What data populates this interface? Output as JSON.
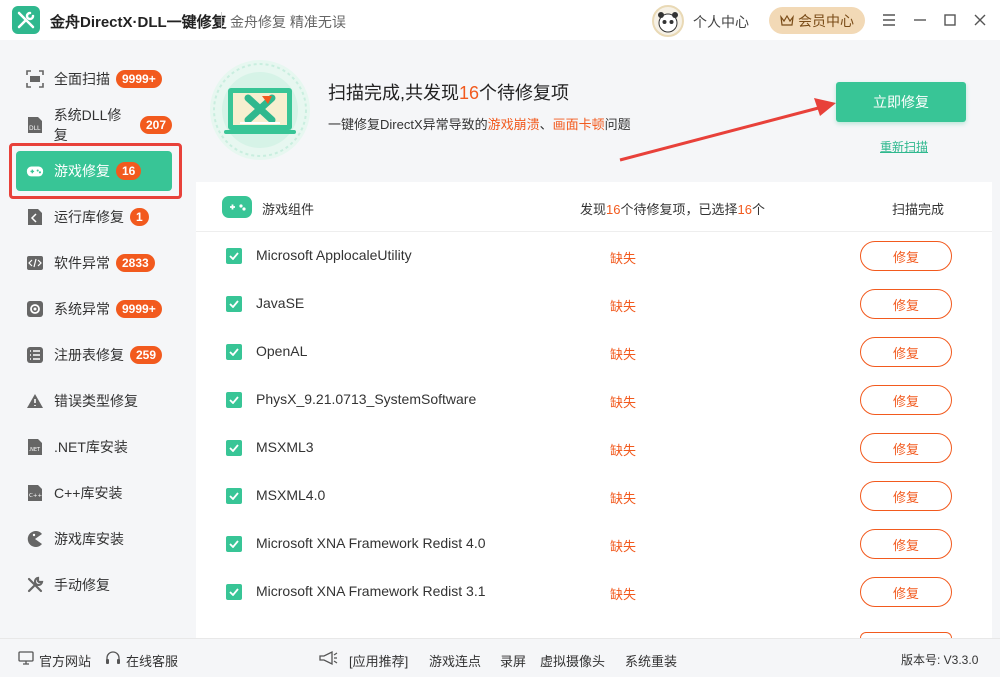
{
  "titlebar": {
    "app_title": "金舟DirectX·DLL一键修复",
    "slogan": "金舟修复 精准无误",
    "user_center": "个人中心",
    "vip_center": "会员中心"
  },
  "sidebar": {
    "items": [
      {
        "label": "全面扫描",
        "badge": "9999+",
        "icon": "scan-icon"
      },
      {
        "label": "系统DLL修复",
        "badge": "207",
        "icon": "dll-icon"
      },
      {
        "label": "游戏修复",
        "badge": "16",
        "icon": "gamepad-icon",
        "active": true
      },
      {
        "label": "运行库修复",
        "badge": "1",
        "icon": "runtime-icon"
      },
      {
        "label": "软件异常",
        "badge": "2833",
        "icon": "code-icon"
      },
      {
        "label": "系统异常",
        "badge": "9999+",
        "icon": "gear-icon"
      },
      {
        "label": "注册表修复",
        "badge": "259",
        "icon": "list-icon"
      },
      {
        "label": "错误类型修复",
        "badge": "",
        "icon": "warning-icon"
      },
      {
        "label": ".NET库安装",
        "badge": "",
        "icon": "dotnet-icon"
      },
      {
        "label": "C++库安装",
        "badge": "",
        "icon": "cpp-icon"
      },
      {
        "label": "游戏库安装",
        "badge": "",
        "icon": "pacman-icon"
      },
      {
        "label": "手动修复",
        "badge": "",
        "icon": "wrench-icon"
      }
    ]
  },
  "hero": {
    "title_prefix": "扫描完成,共发现",
    "title_count": "16",
    "title_suffix": "个待修复项",
    "sub_prefix": "一键修复DirectX异常导致的",
    "sub_hl1": "游戏崩溃",
    "sub_sep": "、",
    "sub_hl2": "画面卡顿",
    "sub_suffix": "问题",
    "fix_now": "立即修复",
    "rescan": "重新扫描"
  },
  "list": {
    "header_title": "游戏组件",
    "found_prefix": "发现",
    "found_count": "16",
    "found_mid": "个待修复项，已选择",
    "selected_count": "16",
    "found_suffix": "个",
    "status_header": "扫描完成",
    "rows": [
      {
        "name": "Microsoft ApplocaleUtility",
        "status": "缺失",
        "action": "修复"
      },
      {
        "name": "JavaSE",
        "status": "缺失",
        "action": "修复"
      },
      {
        "name": "OpenAL",
        "status": "缺失",
        "action": "修复"
      },
      {
        "name": "PhysX_9.21.0713_SystemSoftware",
        "status": "缺失",
        "action": "修复"
      },
      {
        "name": "MSXML3",
        "status": "缺失",
        "action": "修复"
      },
      {
        "name": "MSXML4.0",
        "status": "缺失",
        "action": "修复"
      },
      {
        "name": "Microsoft XNA Framework Redist 4.0",
        "status": "缺失",
        "action": "修复"
      },
      {
        "name": "Microsoft XNA Framework Redist 3.1",
        "status": "缺失",
        "action": "修复"
      }
    ]
  },
  "footer": {
    "website": "官方网站",
    "support": "在线客服",
    "recommend": "[应用推荐]",
    "links": [
      "游戏连点",
      "录屏",
      "虚拟摄像头",
      "系统重装"
    ],
    "version": "版本号: V3.3.0"
  },
  "colors": {
    "accent": "#38c596",
    "warning": "#f25a1e",
    "highlight_border": "#e8413a"
  }
}
